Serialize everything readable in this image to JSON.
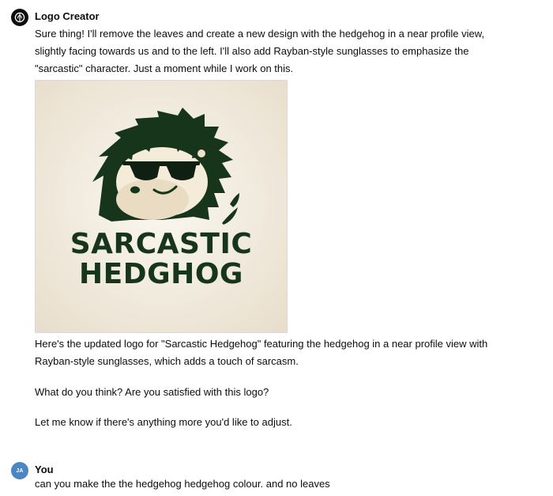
{
  "assistant": {
    "name": "Logo Creator",
    "intro_lines": [
      "Sure thing! I'll remove the leaves and create a new design with the hedgehog in a near profile view,",
      "slightly facing towards us and to the left. I'll also add Rayban-style sunglasses to emphasize the",
      "\"sarcastic\" character. Just a moment while I work on this."
    ],
    "image": {
      "logo_text_line1": "SARCASTIC",
      "logo_text_line2": "HEDGHOG"
    },
    "followup_lines": [
      "Here's the updated logo for \"Sarcastic Hedgehog\" featuring the hedgehog in a near profile view with",
      "Rayban-style sunglasses, which adds a touch of sarcasm."
    ],
    "question": "What do you think? Are you satisfied with this logo?",
    "closing": "Let me know if there's anything more you'd like to adjust."
  },
  "user": {
    "name": "You",
    "initials": "JA",
    "message": "can you make the the hedgehog hedgehog colour. and no leaves"
  },
  "colors": {
    "avatar_bot": "#0d0d0d",
    "avatar_user": "#4a86c5",
    "logo_green": "#16351a",
    "image_bg": "#efe8da"
  }
}
